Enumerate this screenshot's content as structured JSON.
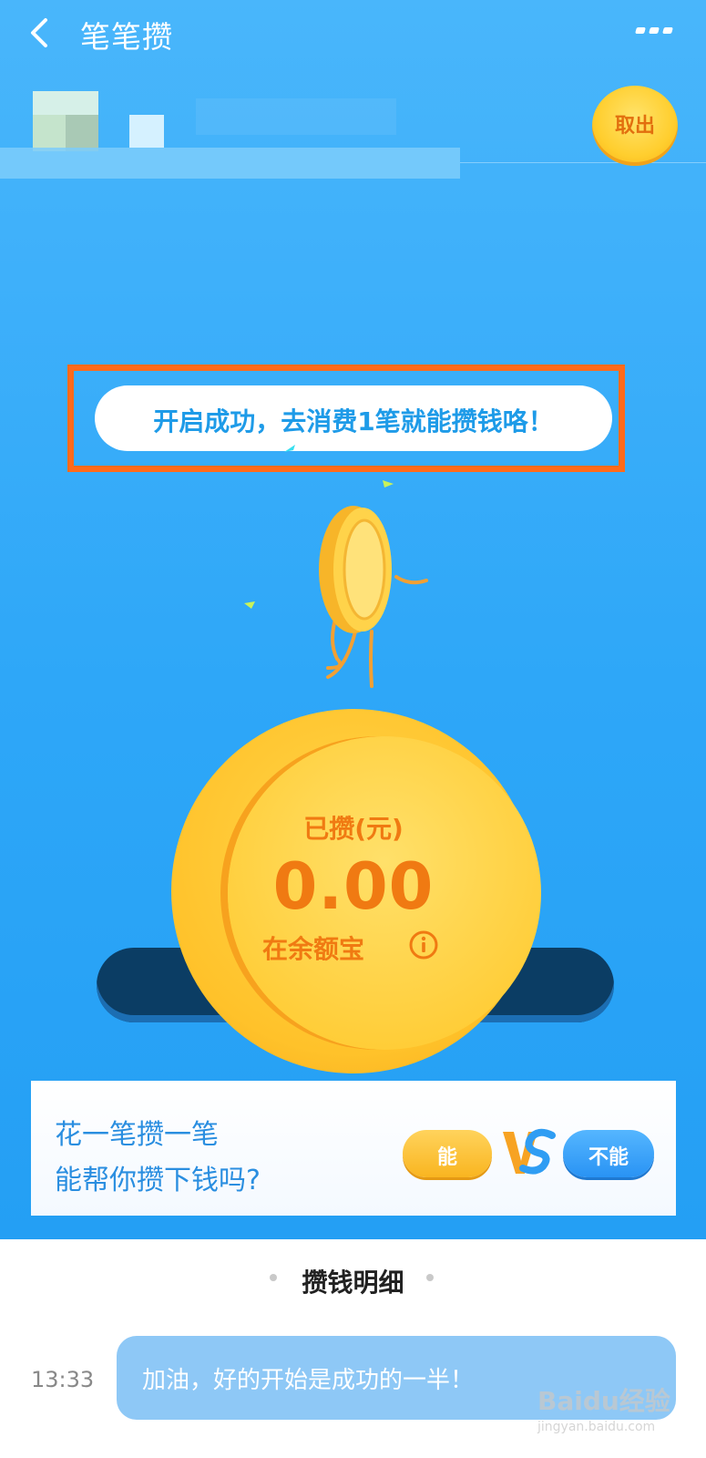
{
  "topbar": {
    "title": "笔笔攒"
  },
  "header": {
    "withdraw_label": "取出"
  },
  "banner": {
    "text": "开启成功，去消费1笔就能攒钱咯！"
  },
  "coin": {
    "label": "已攒(元)",
    "amount": "0.00",
    "location": "在余额宝"
  },
  "vote": {
    "question_line1": "花一笔攒一笔",
    "question_line2": "能帮你攒下钱吗?",
    "yes_label": "能",
    "no_label": "不能"
  },
  "details": {
    "title": "攒钱明细",
    "entries": [
      {
        "time": "13:33",
        "message": "加油，好的开始是成功的一半！"
      }
    ]
  },
  "watermark": {
    "text": "Baidu经验",
    "url": "jingyan.baidu.com"
  },
  "colors": {
    "primary_blue": "#2ea7f8",
    "coin_gold": "#ffc22a",
    "accent_orange": "#ff6a1a"
  }
}
